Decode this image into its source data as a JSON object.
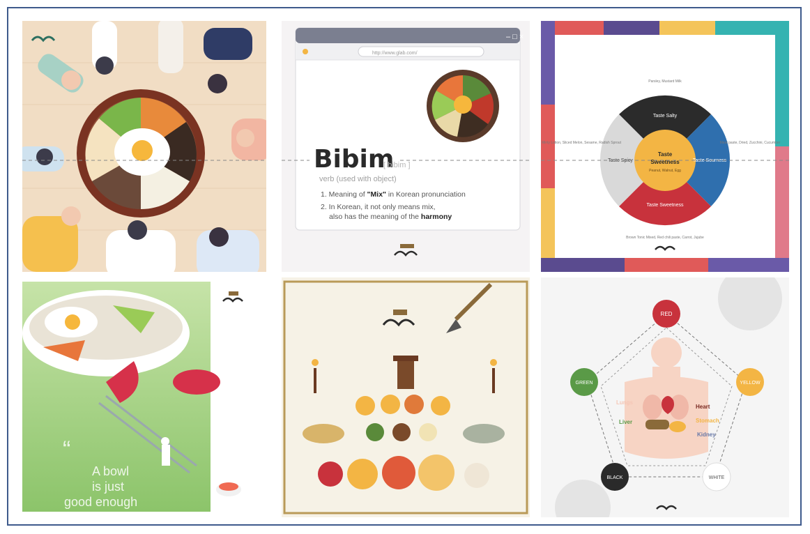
{
  "panel_top_middle": {
    "url": "http://www.glab.com/",
    "headline": "Bibim",
    "pos": "[ bibim ]",
    "definition": "verb (used with object)",
    "item1_pre": "1. Meaning of ",
    "item1_key": "\"Mix\"",
    "item1_post": " in Korean pronunciation",
    "item2_line1": "2. In Korean, it not only means mix,",
    "item2_line2_pre": "also has the meaning of the ",
    "item2_key": "harmony"
  },
  "panel_top_right": {
    "center_title": "Taste",
    "center_sub": "Sweetness",
    "center_note": "Peanut, Walnut, Egg",
    "segments": [
      "Taste Salty",
      "Taste Sourness",
      "Taste Sweetness",
      "Taste Spicy"
    ],
    "side_top": "Parsley, Mustard Milk",
    "side_right": "Meat paste, Dried, Zucchini, Cucumber",
    "side_bottom": "Brown Tonic Mixed, Red chili paste, Carrot, Jujube",
    "side_left": "Minty Lotion, Sliced Melon, Sesame, Radish Sprout"
  },
  "panel_bottom_left": {
    "quote_mark": "“",
    "quote_line1": "A bowl",
    "quote_line2": "is just",
    "quote_line3": "good enough"
  },
  "panel_bottom_right": {
    "nodes": [
      "RED",
      "YELLOW",
      "WHITE",
      "BLACK",
      "GREEN"
    ],
    "organs": [
      "Lungs",
      "Heart",
      "Liver",
      "Stomach",
      "Kidney"
    ]
  },
  "colors": {
    "border": "#3e5a8c",
    "red": "#c8323c",
    "yellow": "#f3b544",
    "green": "#5a9a47",
    "black": "#2a2a2a",
    "blue": "#2f6fae"
  }
}
